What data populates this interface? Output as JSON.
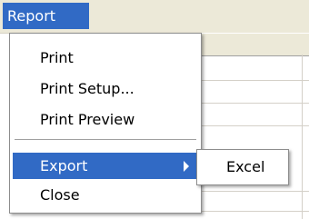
{
  "menubar": {
    "report_label": "Report"
  },
  "dropdown": {
    "items": [
      {
        "label": "Print"
      },
      {
        "label": "Print Setup..."
      },
      {
        "label": "Print Preview"
      },
      {
        "label": "Export"
      },
      {
        "label": "Close"
      }
    ]
  },
  "submenu": {
    "items": [
      {
        "label": "Excel"
      }
    ]
  },
  "colors": {
    "highlight": "#316ac5",
    "menubar": "#ece9d8",
    "border": "#8d8d8d"
  },
  "icons": {
    "submenu_indicator": "chevron-right-icon"
  }
}
